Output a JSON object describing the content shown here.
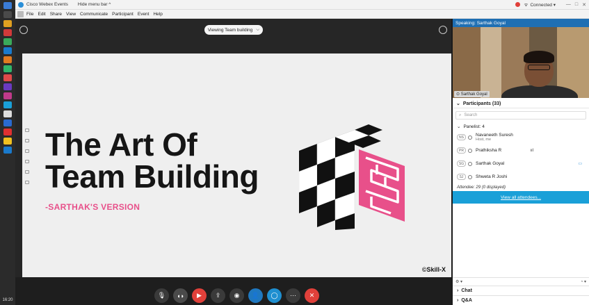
{
  "titlebar": {
    "app_title": "Cisco Webex Events",
    "hide_menu": "Hide menu bar ^",
    "connection": "Connected ▾",
    "win_min": "—",
    "win_max": "□",
    "win_close": "✕"
  },
  "menubar": {
    "items": [
      "File",
      "Edit",
      "Share",
      "View",
      "Communicate",
      "Participant",
      "Event",
      "Help"
    ]
  },
  "stage": {
    "viewing_label": "Viewing Team building",
    "slide": {
      "title_line1": "The Art Of",
      "title_line2": "Team Building",
      "subtitle": "-SARTHAK'S VERSION",
      "copyright": "©Skill-X"
    }
  },
  "taskbar": {
    "clock": "16:20"
  },
  "right_panel": {
    "speaking": "Speaking: Sarthak Goyal",
    "video_label": "Sarthak Goyal",
    "participants_header": "Participants (33)",
    "search_placeholder": "Search",
    "group_label": "Panelist: 4",
    "participants": [
      {
        "initials": "NS",
        "name": "Navaneeth Suresh",
        "sub": "Host, me",
        "extra": ""
      },
      {
        "initials": "PR",
        "name": "Prathiksha R",
        "sub": "",
        "extra": "ııl"
      },
      {
        "initials": "SG",
        "name": "Sarthak Goyal",
        "sub": "",
        "extra": "▭"
      },
      {
        "initials": "SJ",
        "name": "Shweta R Joshi",
        "sub": "",
        "extra": ""
      }
    ],
    "attendee_count": "Attendee: 29 (0 displayed)",
    "view_all": "View all attendees...",
    "chat": "Chat",
    "qa": "Q&A"
  },
  "colors": {
    "accent_blue": "#1aa0d8",
    "slide_pink": "#e8508a",
    "leave_red": "#e0403a"
  }
}
